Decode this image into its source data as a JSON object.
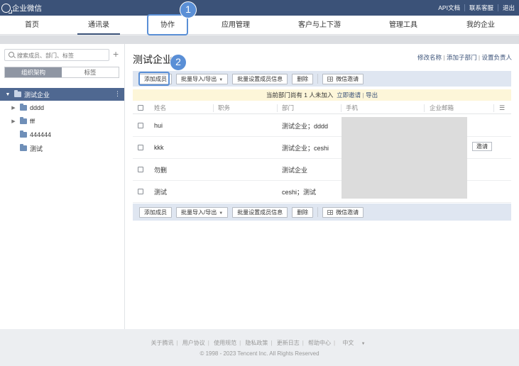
{
  "topbar": {
    "logo_text": "企业微信",
    "links": [
      "API文档",
      "联系客服",
      "退出"
    ]
  },
  "nav": {
    "items": [
      "首页",
      "通讯录",
      "协作",
      "应用管理",
      "客户与上下游",
      "管理工具",
      "我的企业"
    ],
    "active": "通讯录"
  },
  "sidebar": {
    "search_placeholder": "搜索成员、部门、标签",
    "plus": "+",
    "segments": [
      "组织架构",
      "标签"
    ],
    "kebab": "⋮",
    "root": "测试企业",
    "children": [
      "dddd",
      "fff",
      "444444",
      "测试"
    ]
  },
  "main": {
    "title": "测试企业",
    "title_links": [
      "修改名称",
      "添加子部门",
      "设置负责人"
    ],
    "toolbar": {
      "add_member": "添加成员",
      "import_export": "批量导入/导出",
      "batch_set": "批量设置成员信息",
      "delete": "删除",
      "wechat_invite": "微信邀请"
    },
    "notice": {
      "text": "当前部门尚有 1 人未加入",
      "invite_now": "立即邀请",
      "export": "导出"
    },
    "columns": [
      "姓名",
      "职务",
      "部门",
      "手机",
      "企业邮箱"
    ],
    "rows": [
      {
        "name": "hui",
        "dept": "测试企业；dddd"
      },
      {
        "name": "kkk",
        "dept": "测试企业；ceshi"
      },
      {
        "name": "勿删",
        "dept": "测试企业"
      },
      {
        "name": "测试",
        "dept": "ceshi；测试"
      }
    ],
    "invite_label": "邀请"
  },
  "annotations": [
    "1",
    "2"
  ],
  "footer": {
    "links": [
      "关于腾讯",
      "用户协议",
      "使用规范",
      "隐私政策",
      "更新日志",
      "帮助中心",
      "中文"
    ],
    "copyright": "© 1998 - 2023 Tencent Inc. All Rights Reserved"
  },
  "colors": {
    "topbar": "#3b5278",
    "highlight": "#5a8fd6",
    "notice_bg": "#fdf6d9",
    "toolbar_bg": "#dfe6f1"
  }
}
